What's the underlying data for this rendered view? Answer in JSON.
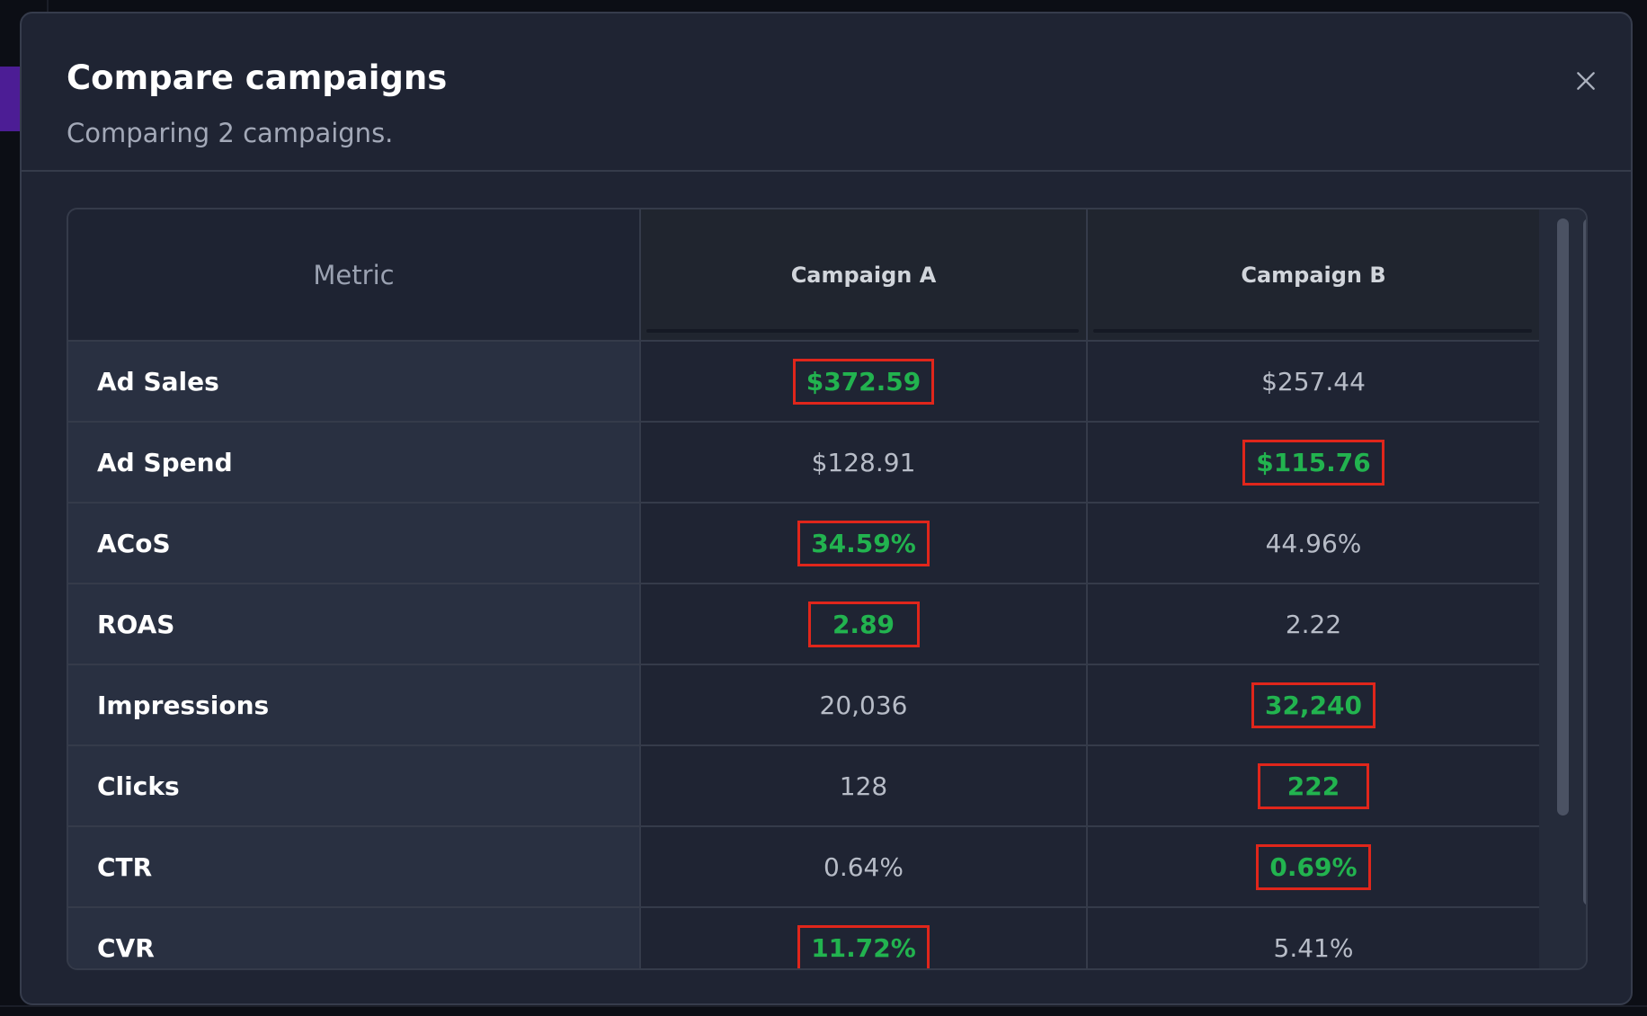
{
  "modal": {
    "title": "Compare campaigns",
    "subtitle": "Comparing 2 campaigns.",
    "close_icon": "close-icon"
  },
  "table": {
    "headers": [
      "Metric",
      "Campaign A",
      "Campaign B"
    ],
    "rows": [
      {
        "metric": "Ad Sales",
        "a": "$372.59",
        "b": "$257.44",
        "best": "a"
      },
      {
        "metric": "Ad Spend",
        "a": "$128.91",
        "b": "$115.76",
        "best": "b"
      },
      {
        "metric": "ACoS",
        "a": "34.59%",
        "b": "44.96%",
        "best": "a"
      },
      {
        "metric": "ROAS",
        "a": "2.89",
        "b": "2.22",
        "best": "a"
      },
      {
        "metric": "Impressions",
        "a": "20,036",
        "b": "32,240",
        "best": "b"
      },
      {
        "metric": "Clicks",
        "a": "128",
        "b": "222",
        "best": "b"
      },
      {
        "metric": "CTR",
        "a": "0.64%",
        "b": "0.69%",
        "best": "b"
      },
      {
        "metric": "CVR",
        "a": "11.72%",
        "b": "5.41%",
        "best": "a"
      }
    ]
  },
  "colors": {
    "best_value": "#22b34f",
    "highlight_border": "#e0261b",
    "modal_bg": "#1f2433"
  }
}
